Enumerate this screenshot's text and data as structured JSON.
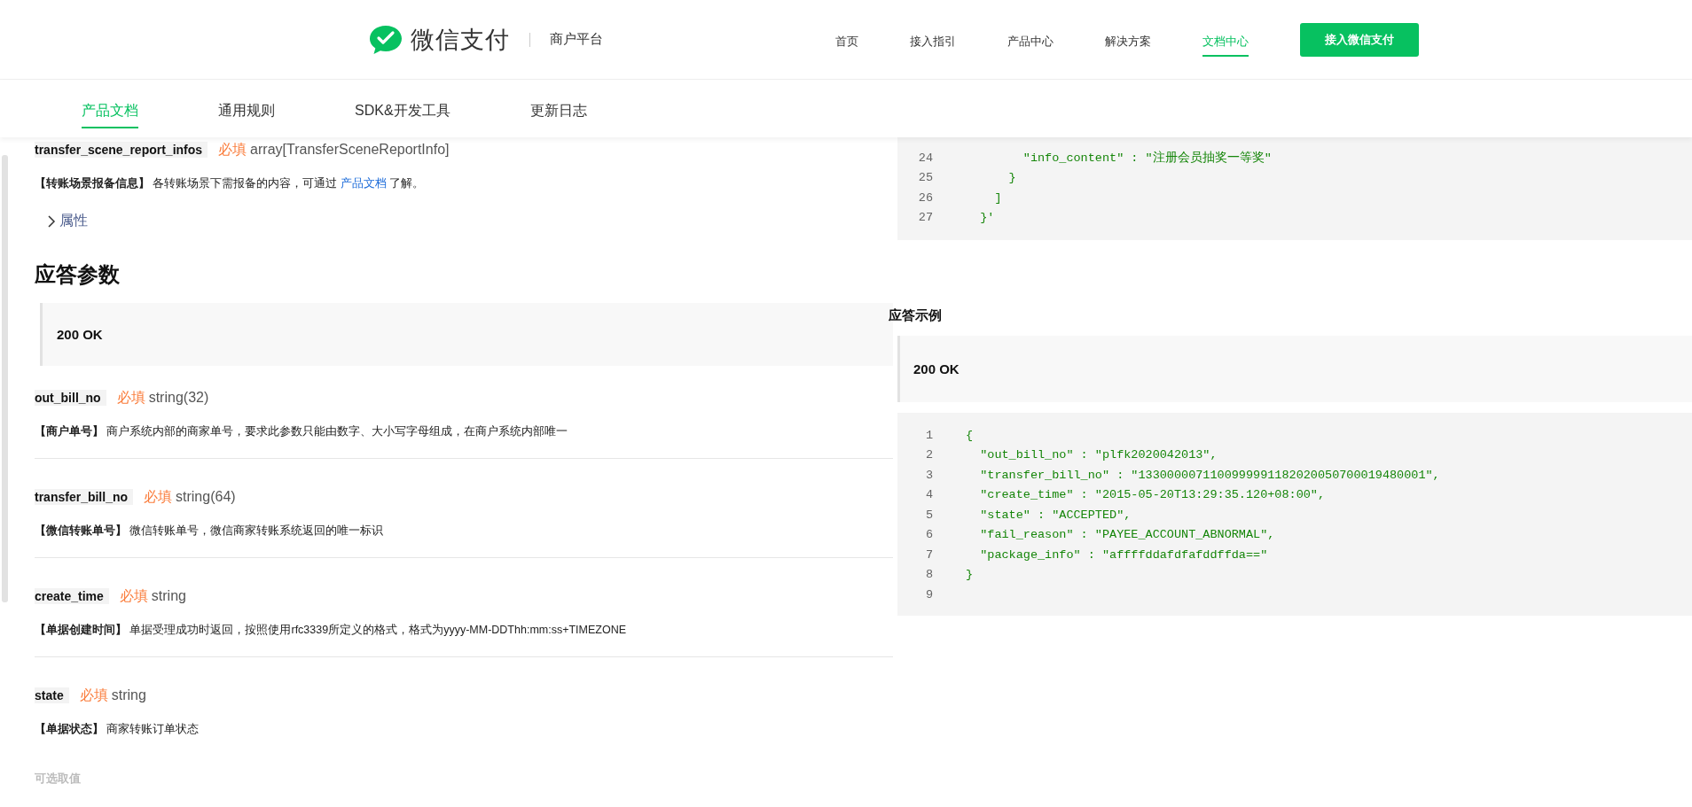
{
  "header": {
    "brand": "微信支付",
    "platform": "商户平台",
    "nav": [
      {
        "label": "首页",
        "selected": false
      },
      {
        "label": "接入指引",
        "selected": false
      },
      {
        "label": "产品中心",
        "selected": false
      },
      {
        "label": "解决方案",
        "selected": false
      },
      {
        "label": "文档中心",
        "selected": true
      }
    ],
    "cta": "接入微信支付"
  },
  "subnav": [
    {
      "label": "产品文档",
      "selected": true
    },
    {
      "label": "通用规则",
      "selected": false
    },
    {
      "label": "SDK&开发工具",
      "selected": false
    },
    {
      "label": "更新日志",
      "selected": false
    }
  ],
  "request_param": {
    "name": "transfer_scene_report_infos",
    "required": "必填",
    "type": "array[TransferSceneReportInfo]",
    "label": "【转账场景报备信息】",
    "description_before": "各转账场景下需报备的内容，可通过",
    "link": "产品文档",
    "description_after": "了解。",
    "expander": {
      "label": "属性",
      "expanded": false
    }
  },
  "response_heading": "应答参数",
  "response_status": "200 OK",
  "response_params": [
    {
      "name": "out_bill_no",
      "required": "必填",
      "type": "string(32)",
      "label": "【商户单号】",
      "description": "商户系统内部的商家单号，要求此参数只能由数字、大小写字母组成，在商户系统内部唯一"
    },
    {
      "name": "transfer_bill_no",
      "required": "必填",
      "type": "string(64)",
      "label": "【微信转账单号】",
      "description": "微信转账单号，微信商家转账系统返回的唯一标识"
    },
    {
      "name": "create_time",
      "required": "必填",
      "type": "string",
      "label": "【单据创建时间】",
      "description": "单据受理成功时返回，按照使用rfc3339所定义的格式，格式为yyyy-MM-DDThh:mm:ss+TIMEZONE"
    },
    {
      "name": "state",
      "required": "必填",
      "type": "string",
      "label": "【单据状态】",
      "description": "商家转账订单状态"
    }
  ],
  "optional_values_label": "可选取值",
  "request_example_code": [
    {
      "number": "24",
      "text": "        \"info_content\" : \"注册会员抽奖一等奖\""
    },
    {
      "number": "25",
      "text": "      }"
    },
    {
      "number": "26",
      "text": "    ]"
    },
    {
      "number": "27",
      "text": "  }'"
    }
  ],
  "response_example": {
    "title": "应答示例",
    "status": "200 OK",
    "code": [
      {
        "number": "1",
        "text": "{"
      },
      {
        "number": "2",
        "text": "  \"out_bill_no\" : \"plfk2020042013\","
      },
      {
        "number": "3",
        "text": "  \"transfer_bill_no\" : \"1330000071100999991182020050700019480001\","
      },
      {
        "number": "4",
        "text": "  \"create_time\" : \"2015-05-20T13:29:35.120+08:00\","
      },
      {
        "number": "5",
        "text": "  \"state\" : \"ACCEPTED\","
      },
      {
        "number": "6",
        "text": "  \"fail_reason\" : \"PAYEE_ACCOUNT_ABNORMAL\","
      },
      {
        "number": "7",
        "text": "  \"package_info\" : \"affffddafdfafddffda==\""
      },
      {
        "number": "8",
        "text": "}"
      },
      {
        "number": "9"
      }
    ]
  }
}
